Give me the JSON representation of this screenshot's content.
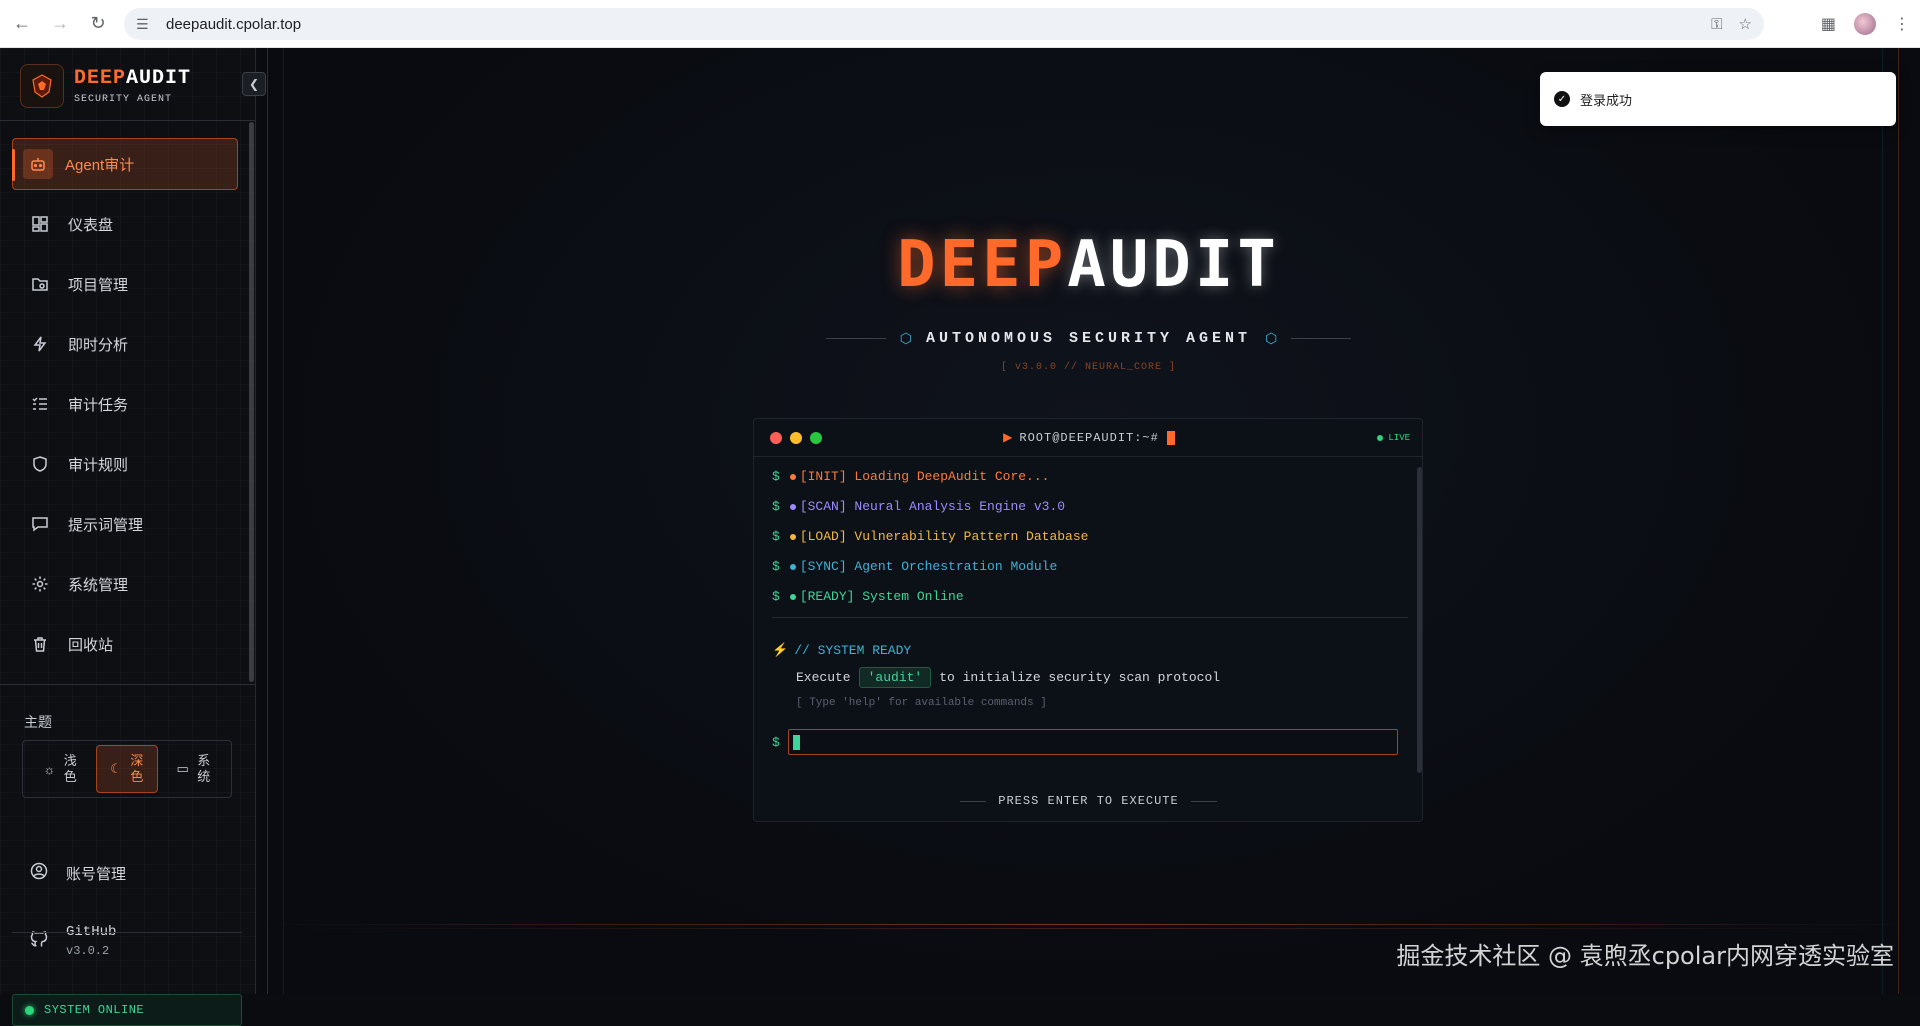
{
  "browser": {
    "url": "deepaudit.cpolar.top"
  },
  "sidebar": {
    "brand": {
      "title_deep": "DEEP",
      "title_audit": "AUDIT",
      "subtitle": "SECURITY AGENT"
    },
    "items": [
      {
        "label": "Agent审计",
        "icon": "robot-icon",
        "active": true
      },
      {
        "label": "仪表盘",
        "icon": "dashboard-icon"
      },
      {
        "label": "项目管理",
        "icon": "folder-icon"
      },
      {
        "label": "即时分析",
        "icon": "lightning-icon"
      },
      {
        "label": "审计任务",
        "icon": "list-check-icon"
      },
      {
        "label": "审计规则",
        "icon": "shield-icon"
      },
      {
        "label": "提示词管理",
        "icon": "message-icon"
      },
      {
        "label": "系统管理",
        "icon": "gear-icon"
      },
      {
        "label": "回收站",
        "icon": "trash-icon"
      }
    ],
    "theme": {
      "label": "主题",
      "options": [
        {
          "label": "浅色",
          "icon": "sun-icon"
        },
        {
          "label": "深色",
          "icon": "moon-icon",
          "active": true
        },
        {
          "label": "系统",
          "icon": "monitor-icon"
        }
      ]
    },
    "account_label": "账号管理",
    "github": {
      "title": "GitHub",
      "version": "v3.0.2"
    },
    "status": "SYSTEM ONLINE"
  },
  "hero": {
    "title_deep": "DEEP",
    "title_audit": "AUDIT",
    "subtitle": "AUTONOMOUS SECURITY AGENT",
    "version": "[ v3.0.0 // NEURAL_CORE ]"
  },
  "terminal": {
    "title": "ROOT@DEEPAUDIT:~#",
    "live": "LIVE",
    "logs": [
      {
        "text": "[INIT] Loading DeepAudit Core...",
        "color": "#ff7a3a"
      },
      {
        "text": "[SCAN] Neural Analysis Engine v3.0",
        "color": "#9c8cff"
      },
      {
        "text": "[LOAD] Vulnerability Pattern Database",
        "color": "#f5b73a"
      },
      {
        "text": "[SYNC] Agent Orchestration Module",
        "color": "#3bb3d6"
      },
      {
        "text": "[READY] System Online",
        "color": "#3ed598"
      }
    ],
    "ready_label": "// SYSTEM READY",
    "execute_prefix": "Execute",
    "execute_code": "'audit'",
    "execute_suffix": "to initialize security scan protocol",
    "help_hint": "[ Type 'help' for available commands ]",
    "press_enter": "PRESS ENTER TO EXECUTE"
  },
  "toast": {
    "message": "登录成功"
  },
  "watermark": "掘金技术社区 @ 袁煦丞cpolar内网穿透实验室"
}
